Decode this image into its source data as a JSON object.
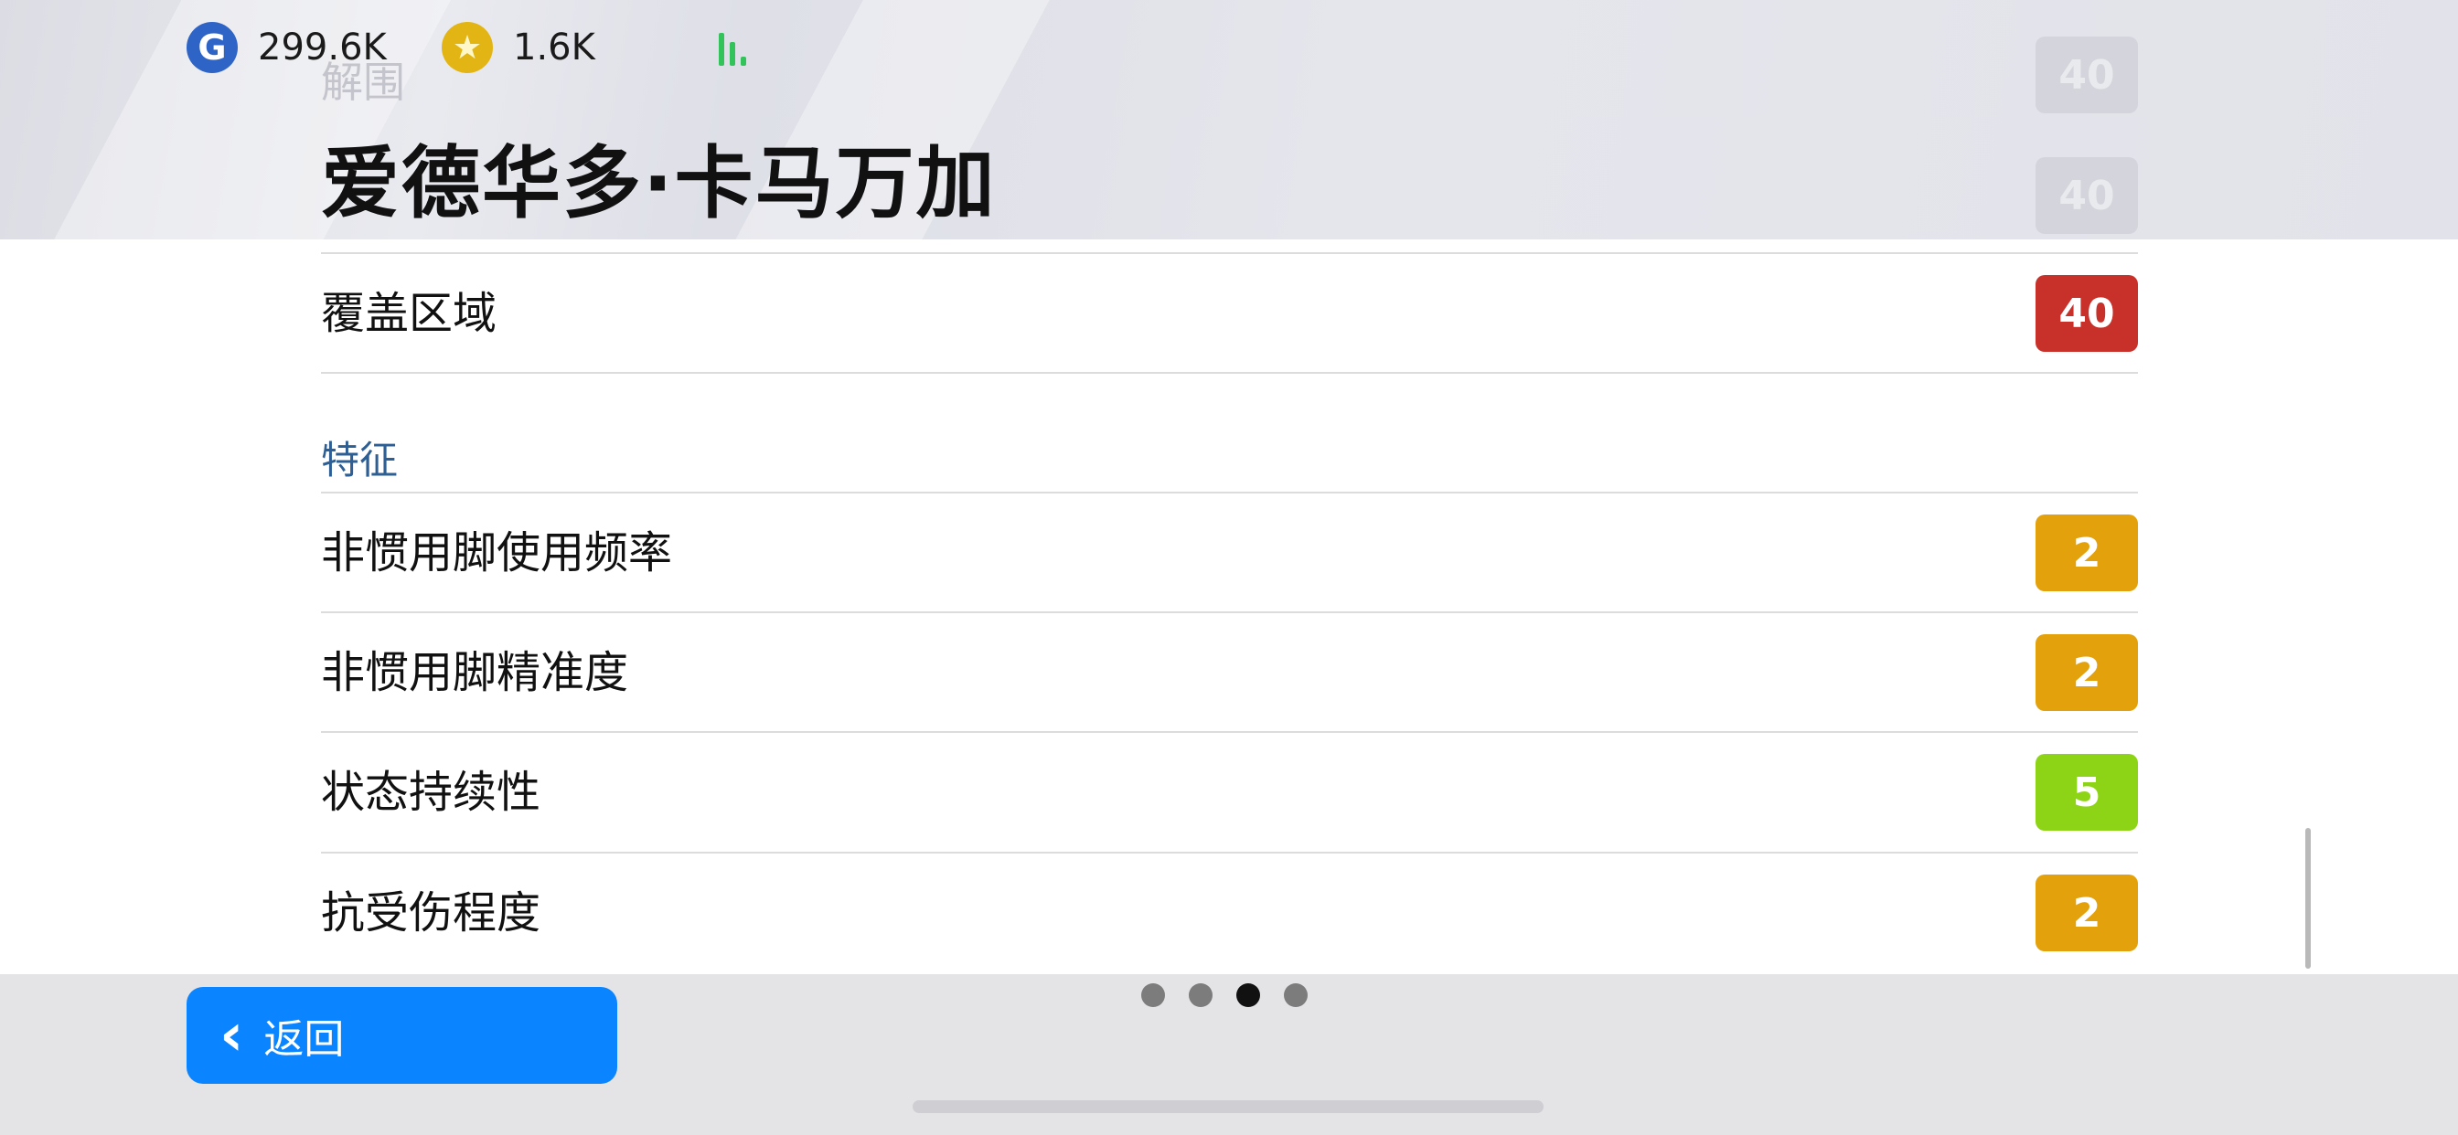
{
  "header": {
    "currencies": [
      {
        "icon": "g-coin-icon",
        "value": "299.6K"
      },
      {
        "icon": "star-coin-icon",
        "value": "1.6K"
      }
    ],
    "signal_icon": "signal-bars-icon",
    "player_name": "爱德华多·卡马万加",
    "ghost_rows": [
      {
        "label": "解围",
        "value": "40"
      },
      {
        "label": "",
        "value": "40"
      }
    ]
  },
  "attributes": [
    {
      "label": "覆盖区域",
      "value": "40",
      "color": "#c8312a"
    }
  ],
  "features_section": {
    "title": "特征",
    "items": [
      {
        "label": "非惯用脚使用频率",
        "value": "2",
        "color": "#e3a10b"
      },
      {
        "label": "非惯用脚精准度",
        "value": "2",
        "color": "#e3a10b"
      },
      {
        "label": "状态持续性",
        "value": "5",
        "color": "#8ed416"
      },
      {
        "label": "抗受伤程度",
        "value": "2",
        "color": "#e3a10b"
      }
    ]
  },
  "footer": {
    "back_label": "返回",
    "back_icon": "chevron-left-icon",
    "pages": 4,
    "active_page": 3
  }
}
